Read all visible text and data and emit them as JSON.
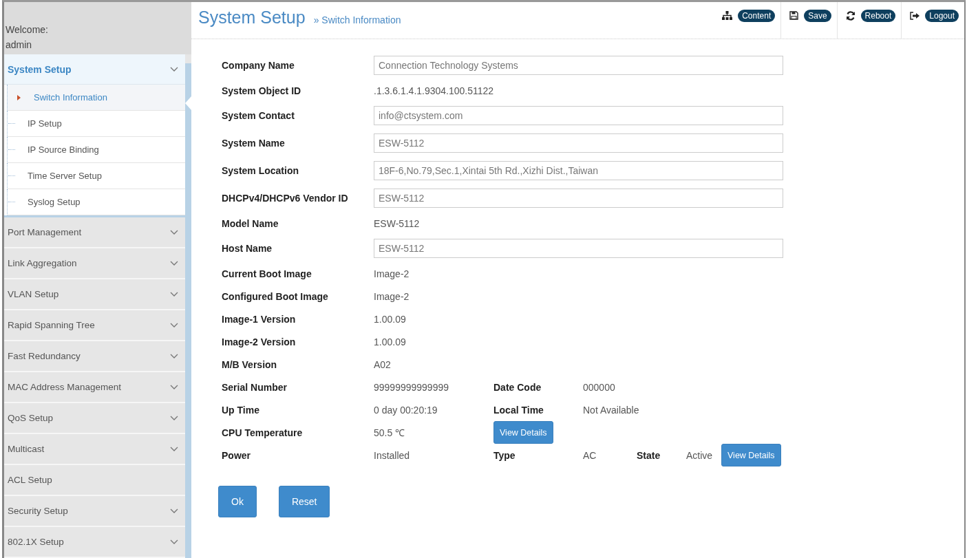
{
  "sidebar": {
    "welcome": "Welcome:",
    "user": "admin",
    "items": [
      {
        "label": "System Setup",
        "expandable": true,
        "expanded": true,
        "children": [
          {
            "label": "Switch Information",
            "selected": true
          },
          {
            "label": "IP Setup",
            "selected": false
          },
          {
            "label": "IP Source Binding",
            "selected": false
          },
          {
            "label": "Time Server Setup",
            "selected": false
          },
          {
            "label": "Syslog Setup",
            "selected": false
          }
        ]
      },
      {
        "label": "Port Management",
        "expandable": true,
        "expanded": false
      },
      {
        "label": "Link Aggregation",
        "expandable": true,
        "expanded": false
      },
      {
        "label": "VLAN Setup",
        "expandable": true,
        "expanded": false
      },
      {
        "label": "Rapid Spanning Tree",
        "expandable": true,
        "expanded": false
      },
      {
        "label": "Fast Redundancy",
        "expandable": true,
        "expanded": false
      },
      {
        "label": "MAC Address Management",
        "expandable": true,
        "expanded": false
      },
      {
        "label": "QoS Setup",
        "expandable": true,
        "expanded": false
      },
      {
        "label": "Multicast",
        "expandable": true,
        "expanded": false
      },
      {
        "label": "ACL Setup",
        "expandable": false,
        "expanded": false
      },
      {
        "label": "Security Setup",
        "expandable": true,
        "expanded": false
      },
      {
        "label": "802.1X Setup",
        "expandable": true,
        "expanded": false
      }
    ]
  },
  "header": {
    "title": "System Setup",
    "breadcrumb": "» Switch Information",
    "actions": [
      {
        "kind": "content",
        "label": "Content"
      },
      {
        "kind": "save",
        "label": "Save"
      },
      {
        "kind": "reboot",
        "label": "Reboot"
      },
      {
        "kind": "logout",
        "label": "Logout"
      }
    ]
  },
  "fields": [
    {
      "kind": "input",
      "label": "Company Name",
      "value": "Connection Technology Systems"
    },
    {
      "kind": "text",
      "label": "System Object ID",
      "value": ".1.3.6.1.4.1.9304.100.51122"
    },
    {
      "kind": "input",
      "label": "System Contact",
      "value": "info@ctsystem.com"
    },
    {
      "kind": "input",
      "label": "System Name",
      "value": "ESW-5112"
    },
    {
      "kind": "input",
      "label": "System Location",
      "value": "18F-6,No.79,Sec.1,Xintai 5th Rd.,Xizhi Dist.,Taiwan"
    },
    {
      "kind": "input",
      "label": "DHCPv4/DHCPv6 Vendor ID",
      "value": "ESW-5112"
    },
    {
      "kind": "text",
      "label": "Model Name",
      "value": "ESW-5112"
    },
    {
      "kind": "input",
      "label": "Host Name",
      "value": "ESW-5112"
    },
    {
      "kind": "text",
      "label": "Current Boot Image",
      "value": "Image-2"
    },
    {
      "kind": "text",
      "label": "Configured Boot Image",
      "value": "Image-2"
    },
    {
      "kind": "text",
      "label": "Image-1 Version",
      "value": "1.00.09"
    },
    {
      "kind": "text",
      "label": "Image-2 Version",
      "value": "1.00.09"
    },
    {
      "kind": "text",
      "label": "M/B Version",
      "value": "A02"
    },
    {
      "kind": "text",
      "label": "Serial Number",
      "value": "99999999999999",
      "extras": [
        {
          "kind": "label",
          "text": "Date Code"
        },
        {
          "kind": "value",
          "text": "000000"
        }
      ]
    },
    {
      "kind": "text",
      "label": "Up Time",
      "value": "0 day 00:20:19",
      "extras": [
        {
          "kind": "label",
          "text": "Local Time"
        },
        {
          "kind": "value",
          "text": "Not Available"
        }
      ]
    },
    {
      "kind": "text",
      "label": "CPU Temperature",
      "value": "50.5 ℃",
      "extras": [
        {
          "kind": "button",
          "text": "View Details"
        }
      ]
    },
    {
      "kind": "text",
      "label": "Power",
      "value": "Installed",
      "extras": [
        {
          "kind": "label",
          "text": "Type"
        },
        {
          "kind": "value",
          "text": "AC"
        },
        {
          "kind": "label",
          "text": "State"
        },
        {
          "kind": "value",
          "text": "Active"
        },
        {
          "kind": "button",
          "text": "View Details"
        }
      ]
    }
  ],
  "buttons": [
    "Ok",
    "Reset"
  ]
}
